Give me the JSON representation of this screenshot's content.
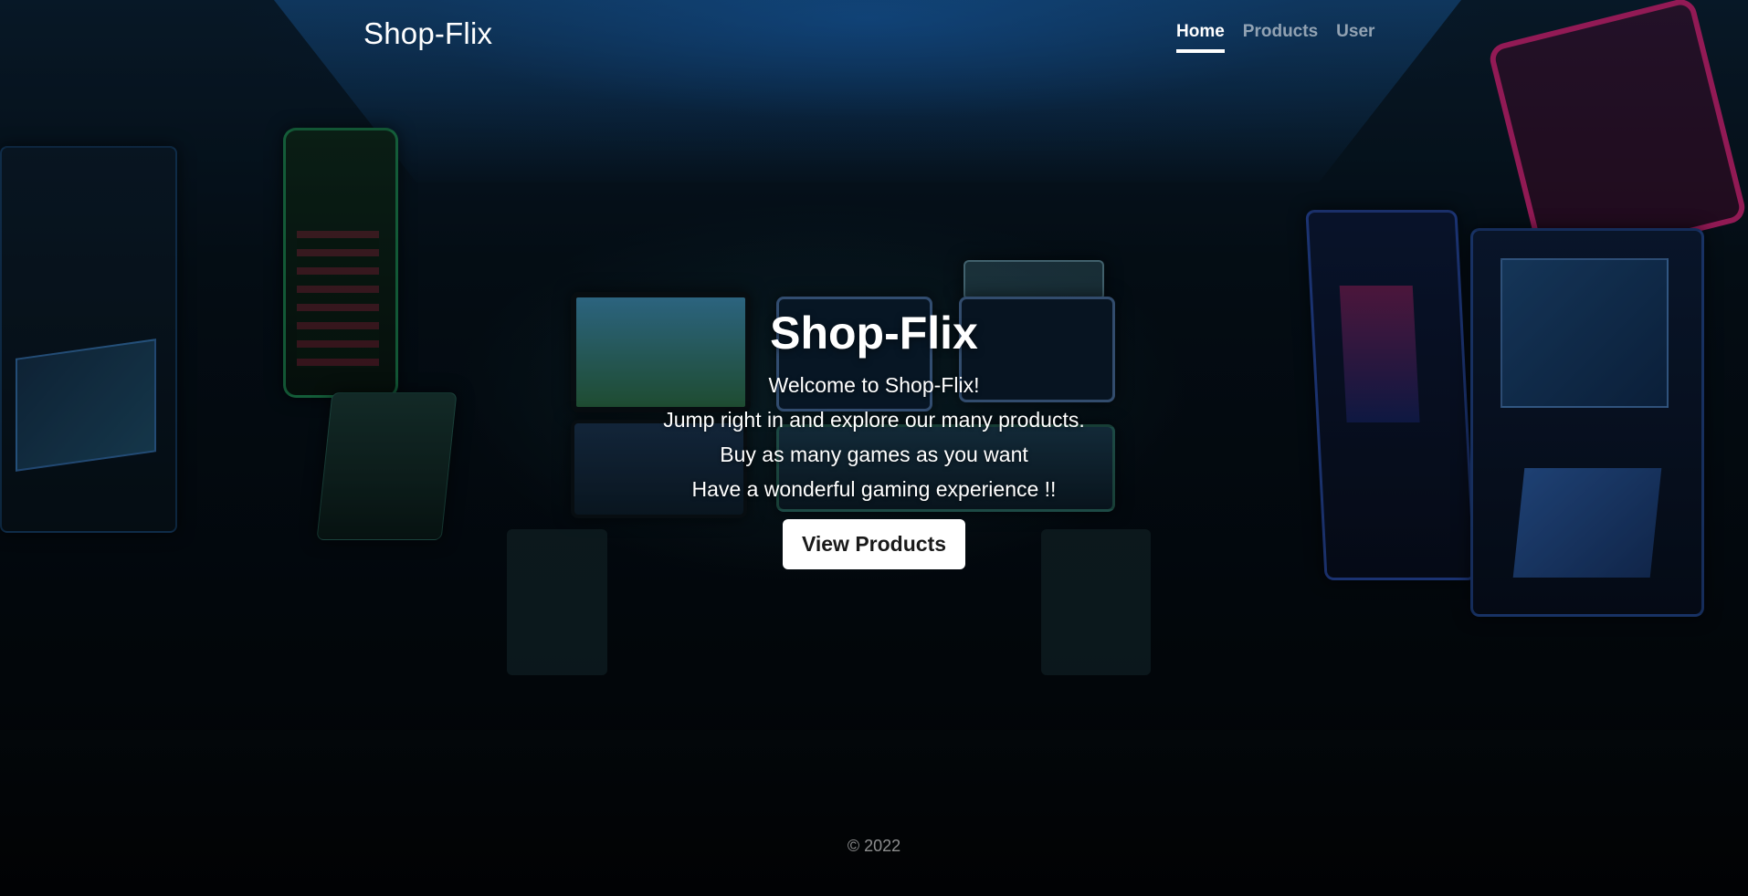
{
  "nav": {
    "brand": "Shop-Flix",
    "links": [
      {
        "label": "Home",
        "active": true
      },
      {
        "label": "Products",
        "active": false
      },
      {
        "label": "User",
        "active": false
      }
    ]
  },
  "hero": {
    "title": "Shop-Flix",
    "lines": [
      "Welcome to Shop-Flix!",
      "Jump right in and explore our many products.",
      "Buy as many games as you want",
      "Have a wonderful gaming experience !!"
    ],
    "cta_label": "View Products"
  },
  "footer": {
    "text": "© 2022"
  },
  "colors": {
    "text": "#ffffff",
    "button_bg": "#ffffff",
    "button_text": "#1a1a1a",
    "background": "#050a10"
  }
}
